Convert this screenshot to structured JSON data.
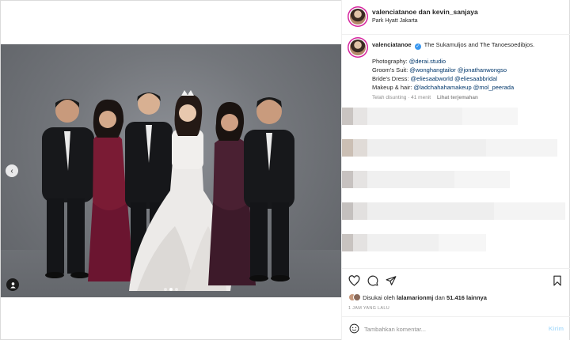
{
  "header": {
    "title": "valenciatanoe dan kevin_sanjaya",
    "location": "Park Hyatt Jakarta"
  },
  "caption": {
    "username": "valenciatanoe",
    "text": "The Sukamuljos and The Tanoesoedibjos.",
    "credits": [
      {
        "label": "Photography: ",
        "mentions": [
          "@derai.studio"
        ]
      },
      {
        "label": "Groom's Suit: ",
        "mentions": [
          "@wonghangtailor",
          "@jonathanwongso"
        ]
      },
      {
        "label": "Bride's Dress: ",
        "mentions": [
          "@eliesaabworld",
          "@eliesaabbridal"
        ]
      },
      {
        "label": "Makeup & hair: ",
        "mentions": [
          "@ladchahahamakeup",
          "@mol_peerada"
        ]
      }
    ],
    "edited": "Telah disunting · 41 menit",
    "translate": "Lihat terjemahan"
  },
  "likes": {
    "prefix": "Disukai oleh ",
    "user": "lalamarionmj",
    "middle": " dan ",
    "count": "51.416 lainnya"
  },
  "timestamp": "1 JAM YANG LALU",
  "comment_input": {
    "placeholder": "Tambahkan komentar...",
    "post_label": "Kirim"
  },
  "carousel": {
    "slides": 3,
    "active": 1
  },
  "icons": {
    "like": "heart-icon",
    "comment": "comment-icon",
    "share": "share-icon",
    "save": "bookmark-icon",
    "prev": "chevron-left-icon",
    "tag": "user-tag-icon",
    "emoji": "emoji-icon"
  },
  "colors": {
    "mention": "#00376b",
    "muted": "#8e8e8e",
    "post_button": "#b2dffc",
    "verified": "#3897f0"
  }
}
